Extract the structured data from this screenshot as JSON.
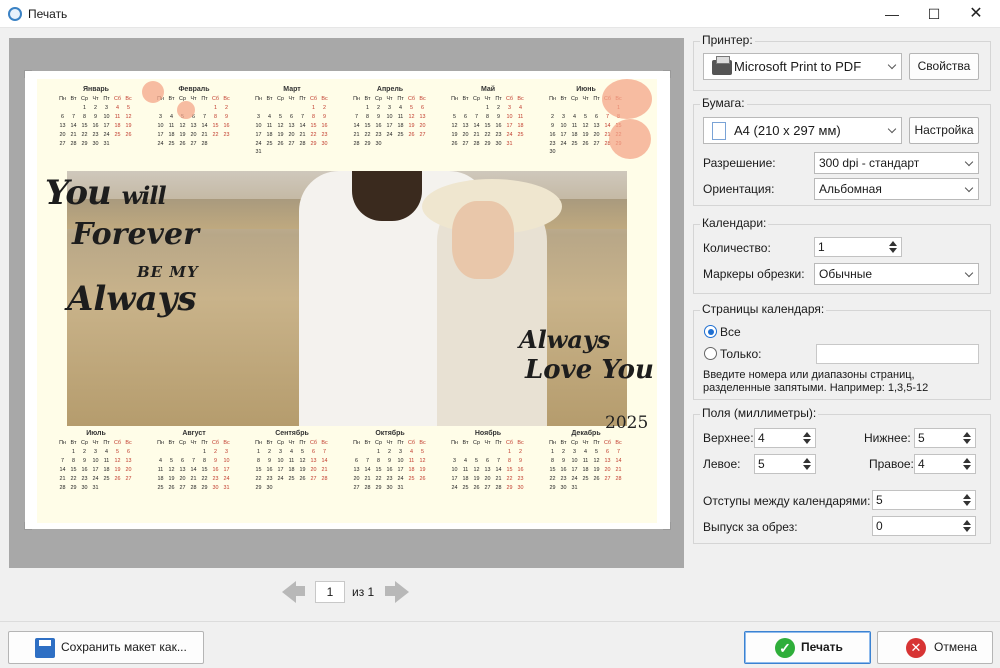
{
  "window": {
    "title": "Печать",
    "min": "—",
    "max": "☐",
    "close": "✕"
  },
  "calendar": {
    "dow": [
      "Пн",
      "Вт",
      "Ср",
      "Чт",
      "Пт",
      "Сб",
      "Вс"
    ],
    "months": [
      {
        "name": "Январь",
        "offset": 2,
        "days": 31
      },
      {
        "name": "Февраль",
        "offset": 5,
        "days": 28
      },
      {
        "name": "Март",
        "offset": 5,
        "days": 31
      },
      {
        "name": "Апрель",
        "offset": 1,
        "days": 30
      },
      {
        "name": "Май",
        "offset": 3,
        "days": 31
      },
      {
        "name": "Июнь",
        "offset": 6,
        "days": 30
      },
      {
        "name": "Июль",
        "offset": 1,
        "days": 31
      },
      {
        "name": "Август",
        "offset": 4,
        "days": 31
      },
      {
        "name": "Сентябрь",
        "offset": 0,
        "days": 30
      },
      {
        "name": "Октябрь",
        "offset": 2,
        "days": 31
      },
      {
        "name": "Ноябрь",
        "offset": 5,
        "days": 30
      },
      {
        "name": "Декабрь",
        "offset": 0,
        "days": 31
      }
    ],
    "text_left": [
      "You",
      "will",
      "Forever",
      "BE MY",
      "Always"
    ],
    "text_right": [
      "Always",
      "Love You"
    ],
    "year": "2025"
  },
  "pager": {
    "current": "1",
    "of": "из 1"
  },
  "printer": {
    "title": "Принтер:",
    "selected": "Microsoft Print to PDF",
    "properties_button": "Свойства"
  },
  "paper": {
    "title": "Бумага:",
    "size": "A4 (210 x 297 мм)",
    "setup_button": "Настройка",
    "resolution_label": "Разрешение:",
    "resolution_value": "300 dpi - стандарт",
    "orientation_label": "Ориентация:",
    "orientation_value": "Альбомная"
  },
  "calendars": {
    "title": "Календари:",
    "count_label": "Количество:",
    "count_value": "1",
    "crop_label": "Маркеры обрезки:",
    "crop_value": "Обычные"
  },
  "pages": {
    "title": "Страницы календаря:",
    "all_label": "Все",
    "only_label": "Только:",
    "only_value": "",
    "hint": "Введите номера или диапазоны страниц, разделенные запятыми. Например: 1,3,5-12"
  },
  "margins": {
    "title": "Поля (миллиметры):",
    "top_label": "Верхнее:",
    "top_value": "4",
    "bottom_label": "Нижнее:",
    "bottom_value": "5",
    "left_label": "Левое:",
    "left_value": "5",
    "right_label": "Правое:",
    "right_value": "4",
    "gap_label": "Отступы между календарями:",
    "gap_value": "5",
    "bleed_label": "Выпуск за обрез:",
    "bleed_value": "0"
  },
  "footer": {
    "save_layout": "Сохранить макет как...",
    "print": "Печать",
    "cancel": "Отмена"
  },
  "colors": {
    "accent": "#3b82d1",
    "weekend": "#c0392b",
    "sheet": "#fffde8"
  }
}
